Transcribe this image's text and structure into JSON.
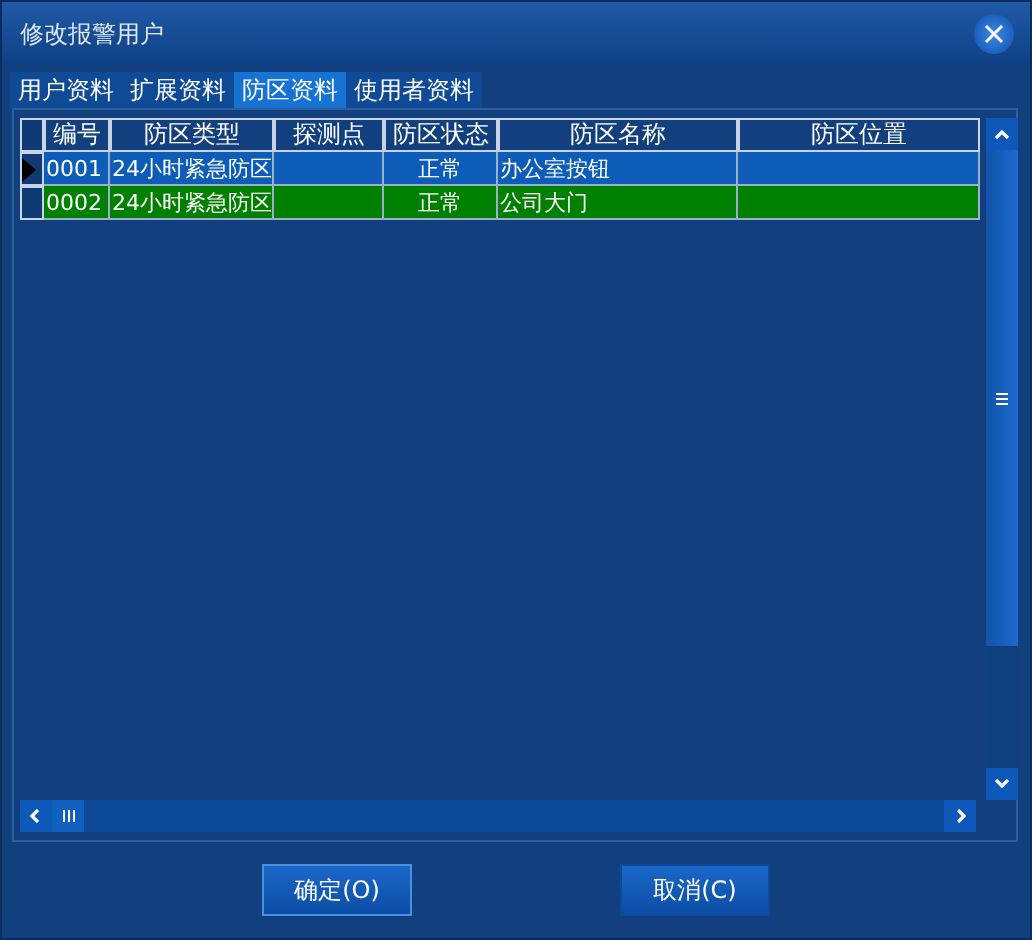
{
  "window": {
    "title": "修改报警用户"
  },
  "tabs": [
    {
      "label": "用户资料",
      "selected": false
    },
    {
      "label": "扩展资料",
      "selected": false
    },
    {
      "label": "防区资料",
      "selected": true
    },
    {
      "label": "使用者资料",
      "selected": false
    }
  ],
  "table": {
    "columns": [
      "编号",
      "防区类型",
      "探测点",
      "防区状态",
      "防区名称",
      "防区位置"
    ],
    "rows": [
      {
        "selected": true,
        "color": "#0c5cb8",
        "cells": [
          "0001",
          "24小时紧急防区",
          "",
          "正常",
          "办公室按钮",
          ""
        ]
      },
      {
        "selected": false,
        "color": "#008000",
        "cells": [
          "0002",
          "24小时紧急防区",
          "",
          "正常",
          "公司大门",
          ""
        ]
      }
    ]
  },
  "buttons": [
    "确定(O)",
    "取消(C)"
  ]
}
